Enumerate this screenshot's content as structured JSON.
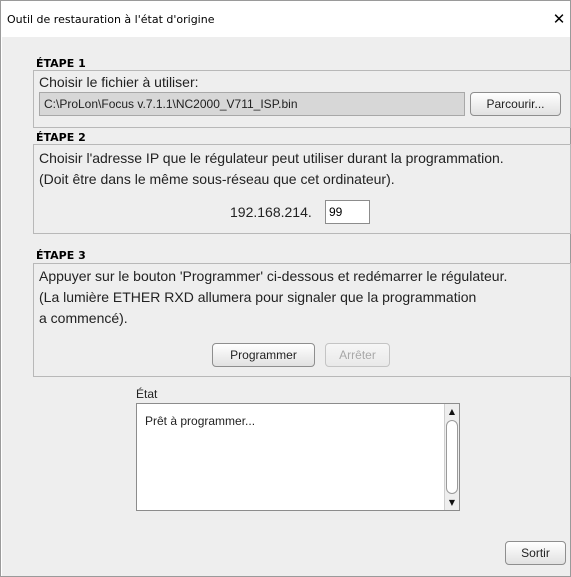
{
  "window": {
    "title": "Outil de restauration à l'état d'origine",
    "close_glyph": "✕"
  },
  "step1": {
    "heading": "ÉTAPE 1",
    "instruction": "Choisir le fichier à utiliser:",
    "file_path": "C:\\ProLon\\Focus v.7.1.1\\NC2000_V711_ISP.bin",
    "browse_label": "Parcourir..."
  },
  "step2": {
    "heading": "ÉTAPE 2",
    "line1": "Choisir l'adresse IP que le régulateur peut utiliser durant la programmation.",
    "line2": "(Doit être dans le même sous-réseau que cet ordinateur).",
    "ip_prefix": "192.168.214.",
    "ip_last_octet": "99"
  },
  "step3": {
    "heading": "ÉTAPE 3",
    "line1": "Appuyer sur le bouton 'Programmer' ci-dessous et redémarrer le régulateur.",
    "line2": "(La lumière ETHER RXD allumera pour signaler que la programmation",
    "line3": "a commencé).",
    "program_label": "Programmer",
    "stop_label": "Arrêter"
  },
  "status": {
    "label": "État",
    "text": "Prêt à programmer..."
  },
  "footer": {
    "exit_label": "Sortir"
  },
  "icons": {
    "scroll_up": "▲",
    "scroll_down": "▼"
  }
}
